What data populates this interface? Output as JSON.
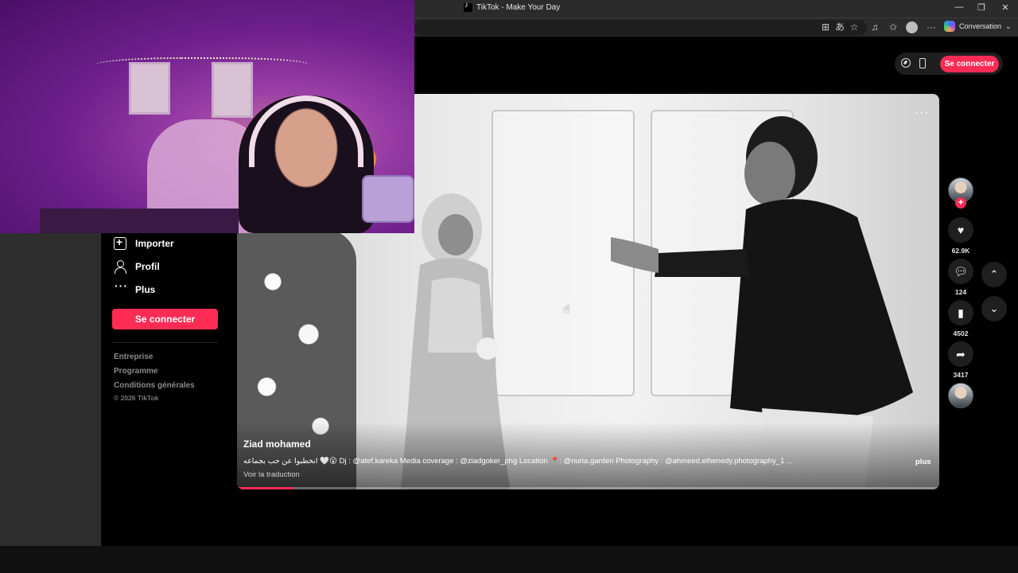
{
  "browser": {
    "tab_title": "TikTok - Make Your Day",
    "window_buttons": [
      "—",
      "❐",
      "✕"
    ],
    "copilot_label": "Conversation"
  },
  "header": {
    "login_label": "Se connecter",
    "icons": [
      "compass-icon",
      "phone-icon"
    ]
  },
  "sidebar": {
    "items": [
      {
        "label": "Importer",
        "icon": "upload-plus-icon"
      },
      {
        "label": "Profil",
        "icon": "person-icon"
      },
      {
        "label": "Plus",
        "icon": "more-dots-icon"
      }
    ],
    "login_label": "Se connecter",
    "footer_links": [
      "Entreprise",
      "Programme",
      "Conditions générales"
    ],
    "copyright": "© 2026 TikTok"
  },
  "video": {
    "author": "Ziad mohamed",
    "caption": "انخطبوا عن حب بجماعه 🤍😮 Dj : @atef.kareka Media coverage : @ziadgoker_phg Location 📍: @nuria.garden Photography : @ahmeed.elhenedy.photography_1 ...",
    "translate_label": "Voir la traduction",
    "more_label": "plus",
    "progress": 0.08,
    "menu_glyph": "···"
  },
  "actions": {
    "likes": "62.9K",
    "comments": "124",
    "saves": "4502",
    "shares": "3417"
  },
  "colors": {
    "accent": "#fe2c55",
    "background": "#000000",
    "button_bg": "#1f1f1f"
  }
}
